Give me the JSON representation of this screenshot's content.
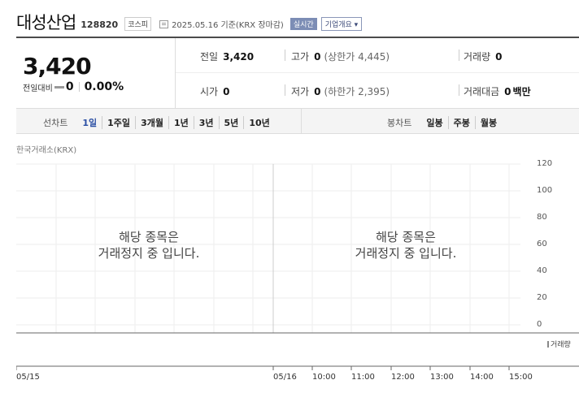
{
  "header": {
    "stock_name": "대성산업",
    "stock_code": "128820",
    "market": "코스피",
    "date_text": "2025.05.16 기준(KRX 장마감)",
    "realtime": "실시간",
    "company_overview": "기업개요 ▾"
  },
  "price": {
    "current": "3,420",
    "diff_label": "전일대비",
    "diff_value": "0",
    "diff_pct": "0.00%"
  },
  "info": {
    "prev_close_label": "전일",
    "prev_close": "3,420",
    "high_label": "고가",
    "high": "0",
    "upper_limit": "(상한가 4,445)",
    "volume_label": "거래량",
    "volume": "0",
    "open_label": "시가",
    "open": "0",
    "low_label": "저가",
    "low": "0",
    "lower_limit": "(하한가 2,395)",
    "amount_label": "거래대금",
    "amount": "0",
    "amount_unit": "백만"
  },
  "tabs": {
    "line_label": "선차트",
    "line_tabs": [
      "1일",
      "1주일",
      "3개월",
      "1년",
      "3년",
      "5년",
      "10년"
    ],
    "line_active": "1일",
    "candle_label": "봉차트",
    "candle_tabs": [
      "일봉",
      "주봉",
      "월봉"
    ]
  },
  "chart": {
    "exchange": "한국거래소(KRX)",
    "halt_line1": "해당 종목은",
    "halt_line2": "거래정지 중 입니다.",
    "y_ticks": [
      "120",
      "100",
      "80",
      "60",
      "40",
      "20",
      "0"
    ],
    "volume_label": "거래량",
    "x_ticks": [
      "05/15",
      "05/16",
      "10:00",
      "11:00",
      "12:00",
      "13:00",
      "14:00",
      "15:00"
    ]
  },
  "colors": {
    "active_tab": "#2b4fa4",
    "realtime_badge": "#7c8db5",
    "grid": "#eeeeee"
  }
}
